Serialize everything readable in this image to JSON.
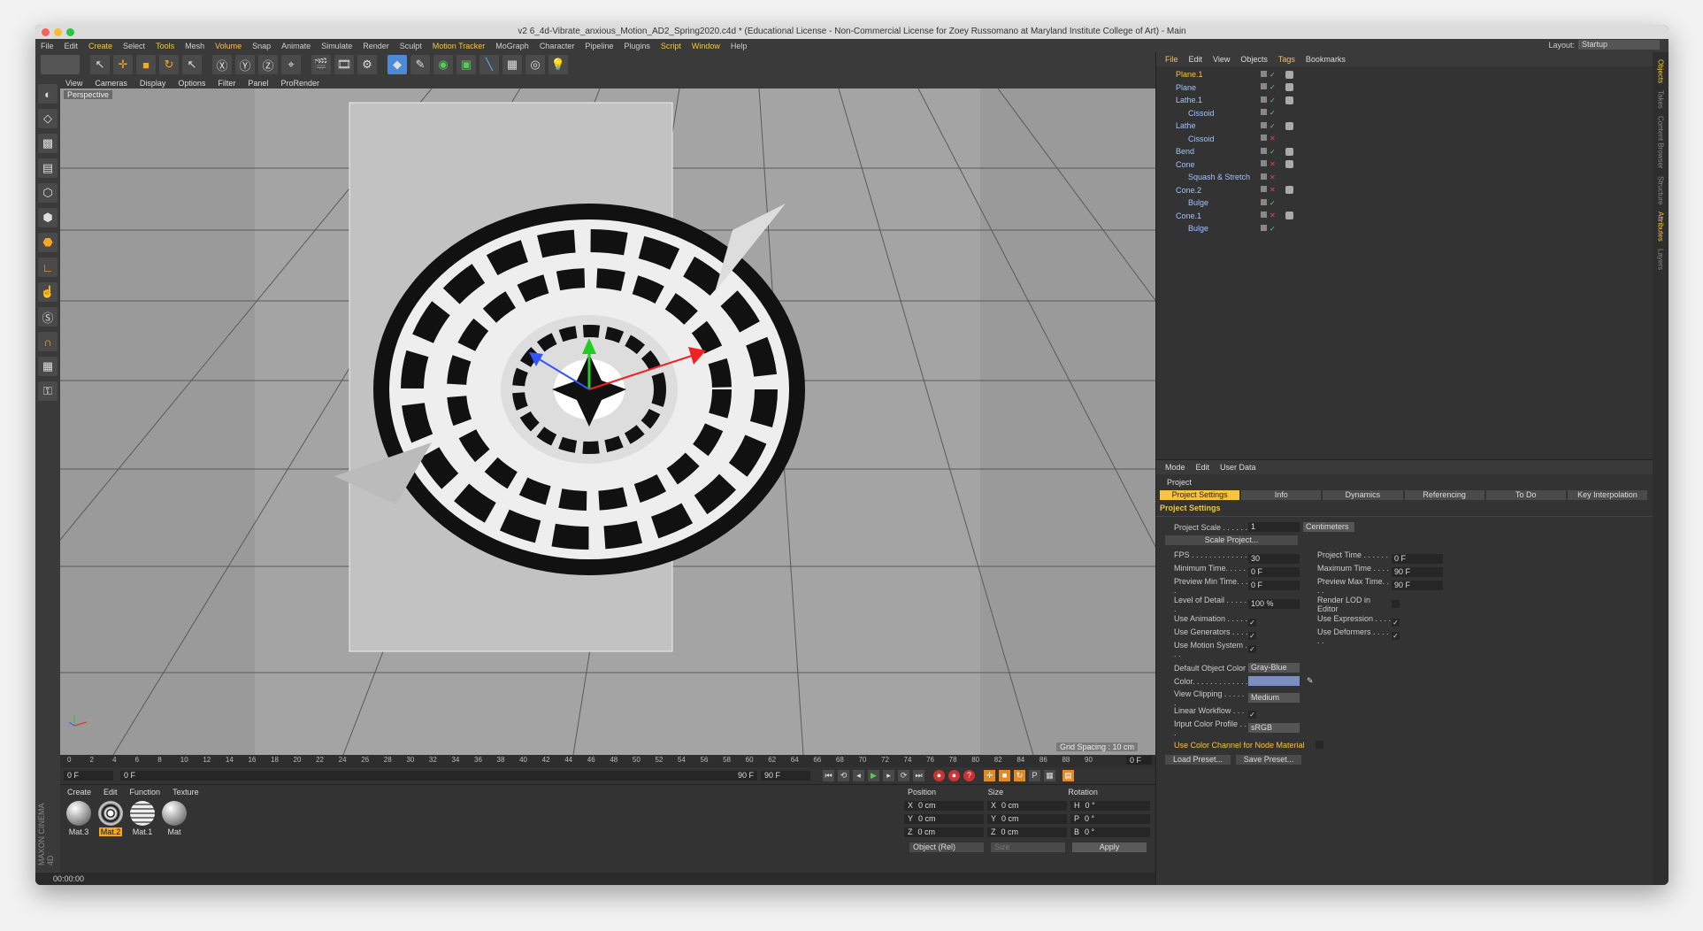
{
  "window": {
    "title": "v2 6_4d-Vibrate_anxious_Motion_AD2_Spring2020.c4d * (Educational License - Non-Commercial License for Zoey Russomano at Maryland Institute College of Art) - Main"
  },
  "menu": [
    "File",
    "Edit",
    "Create",
    "Select",
    "Tools",
    "Mesh",
    "Volume",
    "Snap",
    "Animate",
    "Simulate",
    "Render",
    "Sculpt",
    "Motion Tracker",
    "MoGraph",
    "Character",
    "Pipeline",
    "Plugins",
    "Script",
    "Window",
    "Help"
  ],
  "menu_highlight": [
    "Create",
    "Tools",
    "Volume",
    "Motion Tracker",
    "Script",
    "Window"
  ],
  "layout": {
    "label": "Layout:",
    "value": "Startup"
  },
  "viewport": {
    "menu": [
      "View",
      "Cameras",
      "Display",
      "Options",
      "Filter",
      "Panel",
      "ProRender"
    ],
    "label": "Perspective",
    "grid_spacing": "Grid Spacing : 10 cm"
  },
  "timeline": {
    "ticks": [
      "0",
      "2",
      "4",
      "6",
      "8",
      "10",
      "12",
      "14",
      "16",
      "18",
      "20",
      "22",
      "24",
      "26",
      "28",
      "30",
      "32",
      "34",
      "36",
      "38",
      "40",
      "42",
      "44",
      "46",
      "48",
      "50",
      "52",
      "54",
      "56",
      "58",
      "60",
      "62",
      "64",
      "66",
      "68",
      "70",
      "72",
      "74",
      "76",
      "78",
      "80",
      "82",
      "84",
      "86",
      "88",
      "90"
    ],
    "current_frame": "0 F",
    "start_field": "0 F",
    "slider_start": "0 F",
    "slider_end": "90 F",
    "end_field": "90 F"
  },
  "materials": {
    "menu": [
      "Create",
      "Edit",
      "Function",
      "Texture"
    ],
    "items": [
      {
        "name": "Mat.3",
        "selected": false
      },
      {
        "name": "Mat.2",
        "selected": true
      },
      {
        "name": "Mat.1",
        "selected": false
      },
      {
        "name": "Mat",
        "selected": false
      }
    ]
  },
  "coordinates": {
    "headers": [
      "Position",
      "Size",
      "Rotation"
    ],
    "rows": [
      {
        "axis": "X",
        "pos": "0 cm",
        "saxis": "X",
        "size": "0 cm",
        "raxis": "H",
        "rot": "0 °"
      },
      {
        "axis": "Y",
        "pos": "0 cm",
        "saxis": "Y",
        "size": "0 cm",
        "raxis": "P",
        "rot": "0 °"
      },
      {
        "axis": "Z",
        "pos": "0 cm",
        "saxis": "Z",
        "size": "0 cm",
        "raxis": "B",
        "rot": "0 °"
      }
    ],
    "mode": "Object (Rel)",
    "size_mode": "Size",
    "apply": "Apply"
  },
  "status": "00:00:00",
  "brand": "MAXON CINEMA 4D",
  "object_manager": {
    "menu": [
      "File",
      "Edit",
      "View",
      "Objects",
      "Tags",
      "Bookmarks"
    ],
    "objects": [
      {
        "name": "Plane.1",
        "indent": 0,
        "selected": true,
        "ok": true
      },
      {
        "name": "Plane",
        "indent": 0,
        "selected": false,
        "ok": true
      },
      {
        "name": "Lathe.1",
        "indent": 0,
        "selected": false,
        "ok": true
      },
      {
        "name": "Cissoid",
        "indent": 1,
        "selected": false,
        "ok": true
      },
      {
        "name": "Lathe",
        "indent": 0,
        "selected": false,
        "ok": true
      },
      {
        "name": "Cissoid",
        "indent": 1,
        "selected": false,
        "ok": false
      },
      {
        "name": "Bend",
        "indent": 0,
        "selected": false,
        "ok": true
      },
      {
        "name": "Cone",
        "indent": 0,
        "selected": false,
        "ok": false
      },
      {
        "name": "Squash & Stretch",
        "indent": 1,
        "selected": false,
        "ok": false
      },
      {
        "name": "Cone.2",
        "indent": 0,
        "selected": false,
        "ok": false
      },
      {
        "name": "Bulge",
        "indent": 1,
        "selected": false,
        "ok": true
      },
      {
        "name": "Cone.1",
        "indent": 0,
        "selected": false,
        "ok": false
      },
      {
        "name": "Bulge",
        "indent": 1,
        "selected": false,
        "ok": true
      }
    ]
  },
  "attributes": {
    "menu": [
      "Mode",
      "Edit",
      "User Data"
    ],
    "title": "Project",
    "tabs": [
      "Project Settings",
      "Info",
      "Dynamics",
      "Referencing",
      "To Do",
      "Key Interpolation"
    ],
    "section": "Project Settings",
    "project_scale_label": "Project Scale . . . . . .",
    "project_scale": "1",
    "project_scale_unit": "Centimeters",
    "scale_project_btn": "Scale Project...",
    "fps_label": "FPS . . . . . . . . . . . . . .",
    "fps": "30",
    "project_time_label": "Project Time . . . . . . .",
    "project_time": "0 F",
    "min_time_label": "Minimum Time. . . . . . .",
    "min_time": "0 F",
    "max_time_label": "Maximum Time . . . . . .",
    "max_time": "90 F",
    "pmin_label": "Preview Min Time. . . .",
    "pmin": "0 F",
    "pmax_label": "Preview Max Time. . . .",
    "pmax": "90 F",
    "lod_label": "Level of Detail . . . . . .",
    "lod": "100 %",
    "render_lod_label": "Render LOD in Editor",
    "use_anim_label": "Use Animation . . . . . .",
    "use_expr_label": "Use Expression . . . . .",
    "use_gen_label": "Use Generators . . . . .",
    "use_def_label": "Use Deformers . . . . . .",
    "use_motion_label": "Use Motion System . . .",
    "def_obj_color_label": "Default Object Color",
    "def_obj_color": "Gray-Blue",
    "color_label": "Color. . . . . . . . . . . . .",
    "view_clip_label": "View Clipping . . . . . .",
    "view_clip": "Medium",
    "linear_label": "Linear Workflow . . . . .",
    "icp_label": "Input Color Profile . . .",
    "icp": "sRGB",
    "node_mat_label": "Use Color Channel for Node Material",
    "load_preset": "Load Preset...",
    "save_preset": "Save Preset..."
  },
  "right_tabs": [
    "Objects",
    "Takes",
    "Content Browser",
    "Structure",
    "Attributes",
    "Layers"
  ]
}
